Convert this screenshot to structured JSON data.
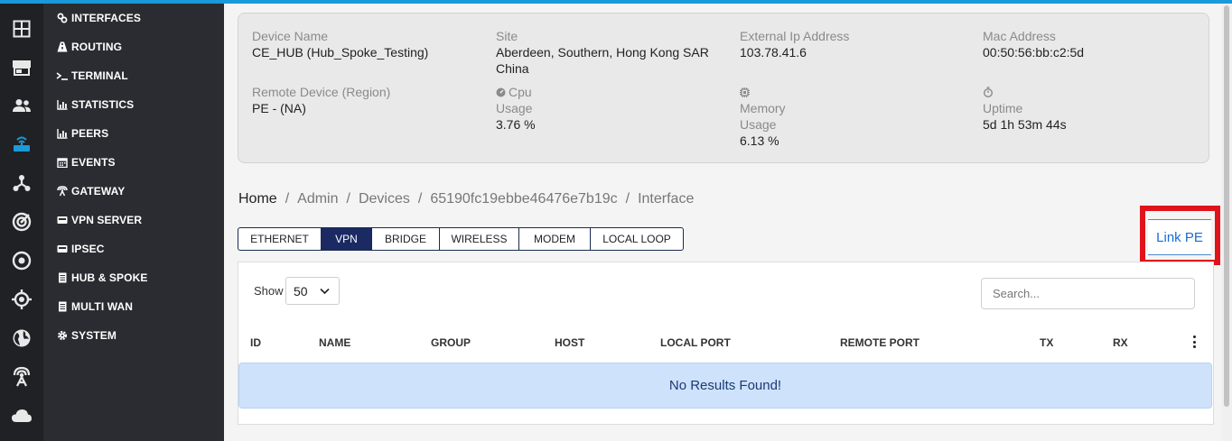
{
  "sidebar_icons": [
    {
      "name": "dashboard-grid-icon",
      "active": false
    },
    {
      "name": "store-icon",
      "active": false
    },
    {
      "name": "users-icon",
      "active": false
    },
    {
      "name": "router-icon",
      "active": true
    },
    {
      "name": "network-nodes-icon",
      "active": false
    },
    {
      "name": "radar-icon",
      "active": false
    },
    {
      "name": "circle-dot-icon",
      "active": false
    },
    {
      "name": "crosshair-icon",
      "active": false
    },
    {
      "name": "globe-icon",
      "active": false
    },
    {
      "name": "antenna-icon",
      "active": false
    },
    {
      "name": "cloud-icon",
      "active": false
    }
  ],
  "menu": {
    "items": [
      {
        "label": "INTERFACES",
        "icon": "link-icon"
      },
      {
        "label": "ROUTING",
        "icon": "routing-icon"
      },
      {
        "label": "TERMINAL",
        "icon": "terminal-icon"
      },
      {
        "label": "STATISTICS",
        "icon": "bar-chart-icon"
      },
      {
        "label": "PEERS",
        "icon": "bar-chart-icon"
      },
      {
        "label": "EVENTS",
        "icon": "calendar-icon"
      },
      {
        "label": "GATEWAY",
        "icon": "gateway-icon"
      },
      {
        "label": "VPN SERVER",
        "icon": "vpn-icon"
      },
      {
        "label": "IPSEC",
        "icon": "vpn-icon"
      },
      {
        "label": "HUB & SPOKE",
        "icon": "document-icon"
      },
      {
        "label": "MULTI WAN",
        "icon": "document-icon"
      },
      {
        "label": "SYSTEM",
        "icon": "gear-icon"
      }
    ]
  },
  "device_info": {
    "device_name_label": "Device Name",
    "device_name": "CE_HUB (Hub_Spoke_Testing)",
    "site_label": "Site",
    "site_line1": "Aberdeen, Southern, Hong Kong SAR",
    "site_line2": "China",
    "external_ip_label": "External Ip Address",
    "external_ip": "103.78.41.6",
    "mac_label": "Mac Address",
    "mac": "00:50:56:bb:c2:5d",
    "remote_label": "Remote Device (Region)",
    "remote": "PE - (NA)",
    "cpu_label_1": "Cpu",
    "cpu_label_2": "Usage",
    "cpu_value": "3.76 %",
    "memory_label_1": "Memory",
    "memory_label_2": "Usage",
    "memory_value": "6.13 %",
    "uptime_label": "Uptime",
    "uptime_value": "5d 1h 53m 44s"
  },
  "breadcrumb": {
    "home": "Home",
    "admin": "Admin",
    "devices": "Devices",
    "device_id": "65190fc19ebbe46476e7b19c",
    "current": "Interface",
    "separator": "/"
  },
  "tabs": [
    {
      "label": "ETHERNET",
      "active": false
    },
    {
      "label": "VPN",
      "active": true
    },
    {
      "label": "BRIDGE",
      "active": false
    },
    {
      "label": "WIRELESS",
      "active": false
    },
    {
      "label": "MODEM",
      "active": false
    },
    {
      "label": "LOCAL LOOP",
      "active": false
    }
  ],
  "link_pe_label": "Link PE",
  "table": {
    "show_label": "Show",
    "page_size": "50",
    "search_placeholder": "Search...",
    "columns": [
      "ID",
      "NAME",
      "GROUP",
      "HOST",
      "LOCAL PORT",
      "REMOTE PORT",
      "TX",
      "RX"
    ],
    "empty_message": "No Results Found!"
  },
  "colors": {
    "accent": "#1a9ad9",
    "tab_active": "#1b2a63",
    "highlight_box": "#e0131a",
    "empty_banner": "#cfe2fb"
  }
}
